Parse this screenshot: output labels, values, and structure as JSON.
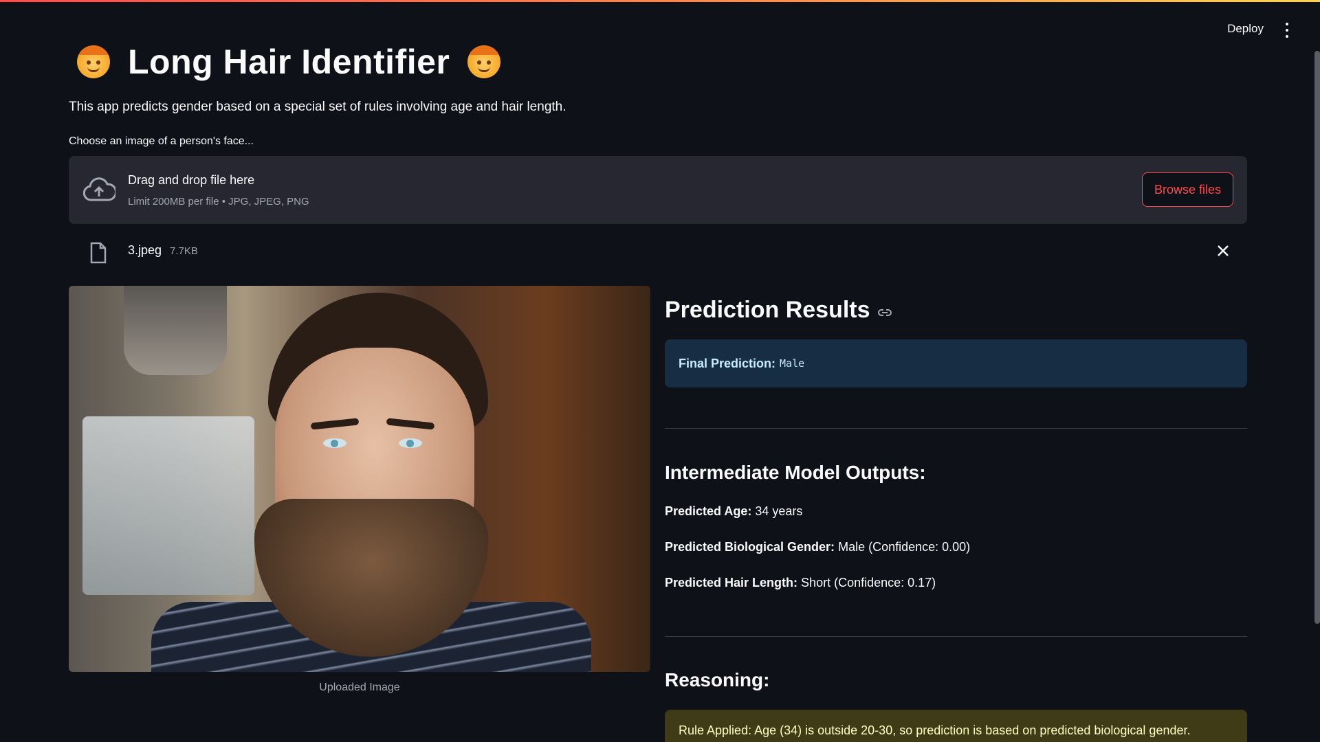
{
  "header": {
    "deploy_label": "Deploy"
  },
  "app": {
    "title": "Long Hair Identifier",
    "subtitle": "This app predicts gender based on a special set of rules involving age and hair length."
  },
  "uploader": {
    "label": "Choose an image of a person's face...",
    "drop_text": "Drag and drop file here",
    "limit_text": "Limit 200MB per file • JPG, JPEG, PNG",
    "browse_label": "Browse files",
    "file": {
      "name": "3.jpeg",
      "size": "7.7KB"
    }
  },
  "image": {
    "caption": "Uploaded Image"
  },
  "results": {
    "heading": "Prediction Results",
    "final_label": "Final Prediction:",
    "final_value": "Male",
    "intermediate_heading": "Intermediate Model Outputs:",
    "age_label": "Predicted Age:",
    "age_value": "34 years",
    "gender_label": "Predicted Biological Gender:",
    "gender_value": "Male (Confidence: 0.00)",
    "hair_label": "Predicted Hair Length:",
    "hair_value": "Short (Confidence: 0.17)",
    "reasoning_heading": "Reasoning:",
    "rule_text": "Rule Applied: Age (34) is outside 20-30, so prediction is based on predicted biological gender."
  },
  "colors": {
    "background": "#0e1117",
    "accent": "#ff4b4b",
    "info_bg": "#172d43",
    "warning_bg": "#3e3b16"
  }
}
